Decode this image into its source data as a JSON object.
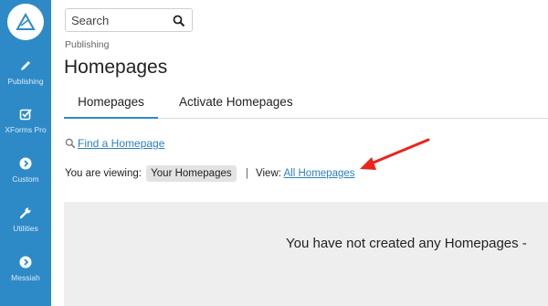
{
  "sidebar": {
    "items": [
      {
        "label": "Publishing",
        "icon": "pencil-icon"
      },
      {
        "label": "XForms Pro",
        "icon": "checkbox-icon"
      },
      {
        "label": "Custom",
        "icon": "chevron-right-circle-icon"
      },
      {
        "label": "Utilities",
        "icon": "wrench-icon"
      },
      {
        "label": "Messiah",
        "icon": "chevron-right-circle-icon"
      }
    ],
    "color": "#2d8ac7"
  },
  "search": {
    "placeholder": "Search"
  },
  "breadcrumb": "Publishing",
  "page_title": "Homepages",
  "tabs": [
    {
      "label": "Homepages",
      "active": true
    },
    {
      "label": "Activate Homepages",
      "active": false
    }
  ],
  "find_link": "Find a Homepage",
  "viewing": {
    "prefix": "You are viewing:",
    "current": "Your Homepages",
    "separator": "|",
    "view_label": "View:",
    "view_link": "All Homepages"
  },
  "empty_message": "You have not created any Homepages -",
  "colors": {
    "accent": "#2d8ac7",
    "link": "#2d7fbd",
    "arrow": "#e8261b"
  }
}
